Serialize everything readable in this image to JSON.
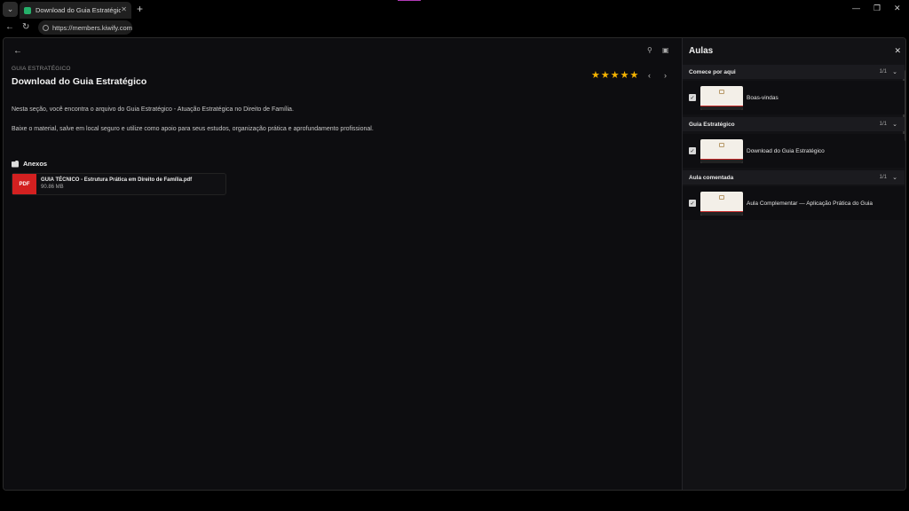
{
  "browser": {
    "tab_title": "Download do Guia Estratégico - Gu",
    "url": "https://members.kiwify.com"
  },
  "page": {
    "eyebrow": "GUIA ESTRATÉGICO",
    "title": "Download do Guia Estratégico",
    "rating": 5,
    "description_1": "Nesta seção, você encontra o arquivo do Guia Estratégico - Atuação Estratégica no Direito de Família.",
    "description_2": "Baixe o material, salve em local seguro e utilize como apoio para seus estudos, organização prática e aprofundamento profissional.",
    "attachments_label": "Anexos",
    "attachment": {
      "type": "PDF",
      "name": "GUIA TÉCNICO - Estrutura Prática em Direito de Família.pdf",
      "size": "90.86 MB"
    }
  },
  "sidebar": {
    "title": "Aulas",
    "sections": [
      {
        "name": "Comece por aqui",
        "count": "1/1",
        "lesson": "Boas-vindas"
      },
      {
        "name": "Guia Estratégico",
        "count": "1/1",
        "lesson": "Download do Guia Estratégico"
      },
      {
        "name": "Aula comentada",
        "count": "1/1",
        "lesson": "Aula Complementar — Aplicação Prática do Guia"
      }
    ]
  },
  "colors": {
    "accent_star": "#f5b301",
    "pdf_red": "#d32020"
  }
}
